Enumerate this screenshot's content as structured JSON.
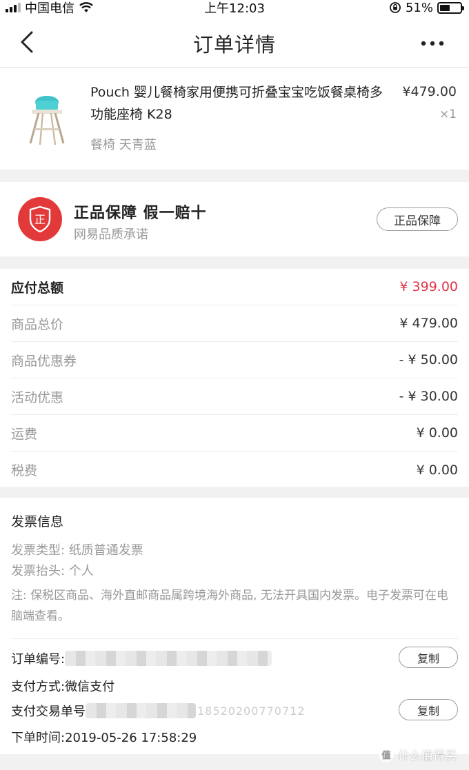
{
  "status_bar": {
    "carrier": "中国电信",
    "time": "上午12:03",
    "battery_percent": "51%",
    "battery_level": 0.51
  },
  "nav": {
    "title": "订单详情"
  },
  "product": {
    "name": "Pouch 婴儿餐椅家用便携可折叠宝宝吃饭餐桌椅多功能座椅  K28",
    "sku": "餐椅 天青蓝",
    "price": "¥479.00",
    "quantity": "×1"
  },
  "guarantee": {
    "title": "正品保障  假一赔十",
    "subtitle": "网易品质承诺",
    "badge_char": "正",
    "button_label": "正品保障"
  },
  "amounts": {
    "rows": [
      {
        "label": "应付总额",
        "value": "¥ 399.00"
      },
      {
        "label": "商品总价",
        "value": "¥ 479.00"
      },
      {
        "label": "商品优惠券",
        "value": "- ¥ 50.00"
      },
      {
        "label": "活动优惠",
        "value": "- ¥ 30.00"
      },
      {
        "label": "运费",
        "value": "¥ 0.00"
      },
      {
        "label": "税费",
        "value": "¥ 0.00"
      }
    ]
  },
  "invoice": {
    "heading": "发票信息",
    "type_line": "发票类型:  纸质普通发票",
    "title_line": "发票抬头:  个人",
    "note": "注:  保税区商品、海外直邮商品属跨境海外商品,  无法开具国内发票。电子发票可在电脑端查看。"
  },
  "order": {
    "number_label": "订单编号:",
    "payment_method": "支付方式:微信支付",
    "transaction_label": "支付交易单号",
    "transaction_tail": "18520200770712",
    "order_time": "下单时间:2019-05-26 17:58:29",
    "copy_label": "复制"
  },
  "watermark": {
    "text": "什么值得买",
    "logo_char": "值"
  },
  "colors": {
    "accent_red": "#e0364a",
    "badge_red": "#e23a3a",
    "muted_text": "#999999"
  },
  "icons": {
    "back": "chevron-left-icon",
    "more": "more-dots-icon",
    "wifi": "wifi-icon",
    "battery": "battery-icon",
    "lock": "orientation-lock-icon",
    "badge": "shield-badge-icon"
  }
}
